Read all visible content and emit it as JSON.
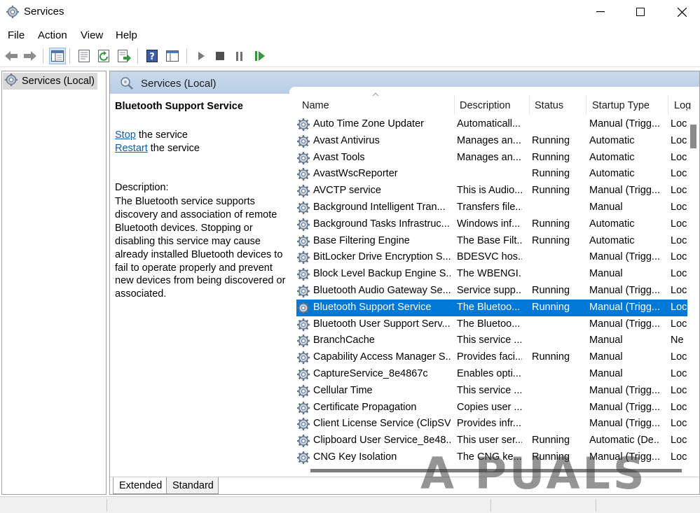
{
  "window": {
    "title": "Services"
  },
  "menu": [
    "File",
    "Action",
    "View",
    "Help"
  ],
  "tree": {
    "root": "Services (Local)"
  },
  "main_header": {
    "title": "Services (Local)"
  },
  "detail": {
    "service_name": "Bluetooth Support Service",
    "stop_link": "Stop",
    "stop_suffix": " the service",
    "restart_link": "Restart",
    "restart_suffix": " the service",
    "description_label": "Description:",
    "description": "The Bluetooth service supports discovery and association of remote Bluetooth devices.  Stopping or disabling this service may cause already installed Bluetooth devices to fail to operate properly and prevent new devices from being discovered or associated."
  },
  "columns": {
    "name": "Name",
    "description": "Description",
    "status": "Status",
    "startup": "Startup Type",
    "logon": "Log"
  },
  "services": [
    {
      "name": "Auto Time Zone Updater",
      "description": "Automaticall...",
      "status": "",
      "startup": "Manual (Trigg...",
      "logon": "Loc"
    },
    {
      "name": "Avast Antivirus",
      "description": "Manages an...",
      "status": "Running",
      "startup": "Automatic",
      "logon": "Loc"
    },
    {
      "name": "Avast Tools",
      "description": "Manages an...",
      "status": "Running",
      "startup": "Automatic",
      "logon": "Loc"
    },
    {
      "name": "AvastWscReporter",
      "description": "",
      "status": "Running",
      "startup": "Automatic",
      "logon": "Loc"
    },
    {
      "name": "AVCTP service",
      "description": "This is Audio...",
      "status": "Running",
      "startup": "Manual (Trigg...",
      "logon": "Loc"
    },
    {
      "name": "Background Intelligent Tran...",
      "description": "Transfers file...",
      "status": "",
      "startup": "Manual",
      "logon": "Loc"
    },
    {
      "name": "Background Tasks Infrastruc...",
      "description": "Windows inf...",
      "status": "Running",
      "startup": "Automatic",
      "logon": "Loc"
    },
    {
      "name": "Base Filtering Engine",
      "description": "The Base Filt...",
      "status": "Running",
      "startup": "Automatic",
      "logon": "Loc"
    },
    {
      "name": "BitLocker Drive Encryption S...",
      "description": "BDESVC hos...",
      "status": "",
      "startup": "Manual (Trigg...",
      "logon": "Loc"
    },
    {
      "name": "Block Level Backup Engine S...",
      "description": "The WBENGI...",
      "status": "",
      "startup": "Manual",
      "logon": "Loc"
    },
    {
      "name": "Bluetooth Audio Gateway Se...",
      "description": "Service supp...",
      "status": "Running",
      "startup": "Manual (Trigg...",
      "logon": "Loc"
    },
    {
      "name": "Bluetooth Support Service",
      "description": "The Bluetoo...",
      "status": "Running",
      "startup": "Manual (Trigg...",
      "logon": "Loc",
      "selected": true
    },
    {
      "name": "Bluetooth User Support Serv...",
      "description": "The Bluetoo...",
      "status": "",
      "startup": "Manual (Trigg...",
      "logon": "Loc"
    },
    {
      "name": "BranchCache",
      "description": "This service ...",
      "status": "",
      "startup": "Manual",
      "logon": "Ne"
    },
    {
      "name": "Capability Access Manager S...",
      "description": "Provides faci...",
      "status": "Running",
      "startup": "Manual",
      "logon": "Loc"
    },
    {
      "name": "CaptureService_8e4867c",
      "description": "Enables opti...",
      "status": "",
      "startup": "Manual",
      "logon": "Loc"
    },
    {
      "name": "Cellular Time",
      "description": "This service ...",
      "status": "",
      "startup": "Manual (Trigg...",
      "logon": "Loc"
    },
    {
      "name": "Certificate Propagation",
      "description": "Copies user ...",
      "status": "",
      "startup": "Manual (Trigg...",
      "logon": "Loc"
    },
    {
      "name": "Client License Service (ClipSV...",
      "description": "Provides infr...",
      "status": "",
      "startup": "Manual (Trigg...",
      "logon": "Loc"
    },
    {
      "name": "Clipboard User Service_8e48...",
      "description": "This user ser...",
      "status": "Running",
      "startup": "Automatic (De...",
      "logon": "Loc"
    },
    {
      "name": "CNG Key Isolation",
      "description": "The CNG ke...",
      "status": "Running",
      "startup": "Manual (Trigg...",
      "logon": "Loc"
    }
  ],
  "tabs": [
    "Extended",
    "Standard"
  ],
  "watermark": "A PUALS"
}
